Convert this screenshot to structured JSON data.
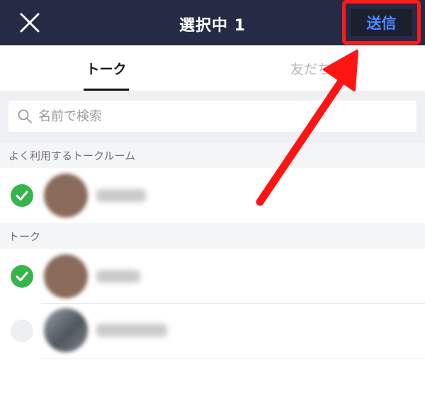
{
  "header": {
    "title": "選択中 1",
    "send_label": "送信"
  },
  "tabs": [
    {
      "label": "トーク",
      "selected": true
    },
    {
      "label": "友だち",
      "selected": false
    }
  ],
  "search": {
    "placeholder": "名前で検索",
    "value": ""
  },
  "sections": [
    {
      "header": "よく利用するトークルーム",
      "rows": [
        {
          "checked": true
        }
      ]
    },
    {
      "header": "トーク",
      "rows": [
        {
          "checked": true
        },
        {
          "checked": false
        }
      ]
    }
  ],
  "colors": {
    "header_bg": "#252b45",
    "send_text": "#4a8bff",
    "check_on": "#36b54a",
    "highlight_red": "#ff1a1a"
  },
  "icons": {
    "close": "close-icon",
    "search": "search-icon",
    "check": "check-icon",
    "annotation": "red-arrow"
  }
}
